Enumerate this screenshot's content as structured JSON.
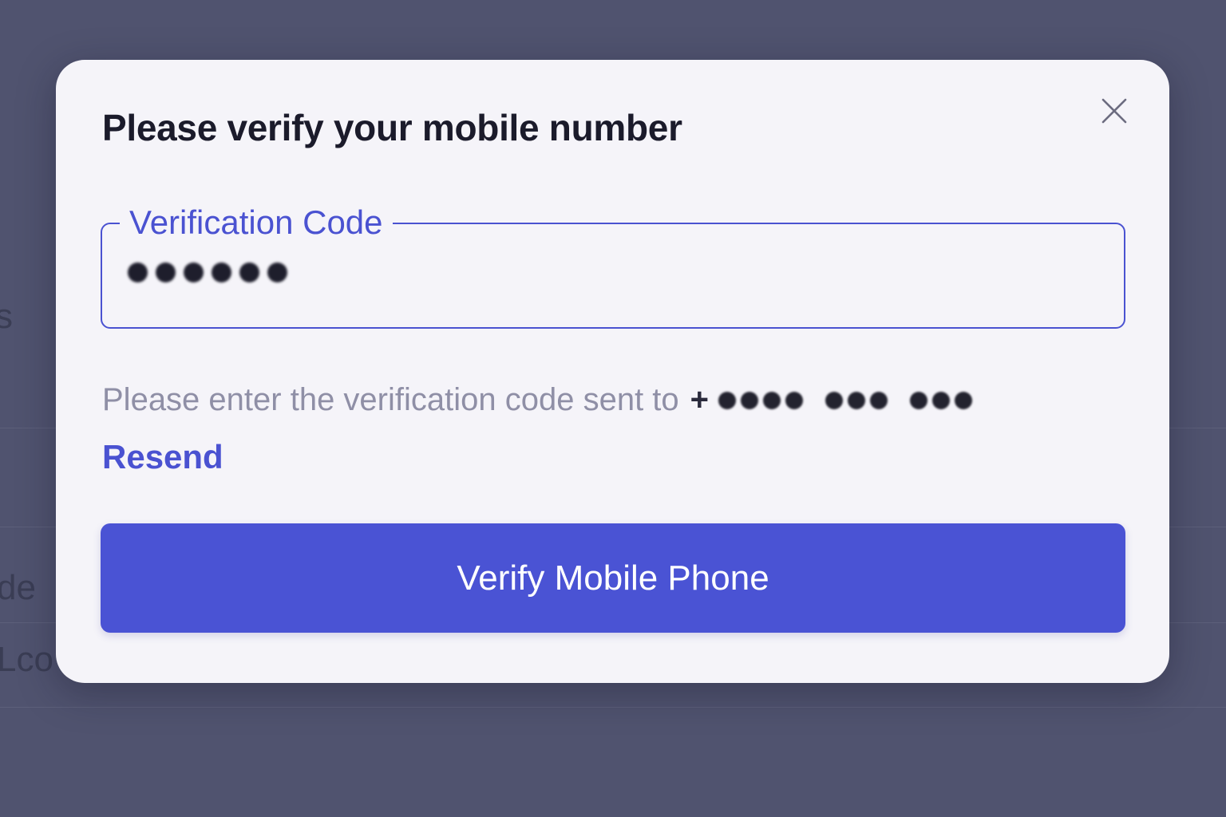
{
  "background": {
    "fragments": [
      "s",
      "de",
      "Lco"
    ]
  },
  "modal": {
    "title": "Please verify your mobile number",
    "close_icon": "close-icon",
    "field": {
      "label": "Verification Code",
      "masked_value": "••••••"
    },
    "helper_text": "Please enter the verification code sent to",
    "phone_prefix": "+",
    "phone_masked": "•••• ••• •••",
    "resend_label": "Resend",
    "primary_button_label": "Verify Mobile Phone"
  },
  "colors": {
    "overlay": "#50536f",
    "modal_bg": "#f5f4f9",
    "accent": "#4a52d1",
    "title": "#1b1b2b",
    "helper": "#8f8fa6"
  }
}
